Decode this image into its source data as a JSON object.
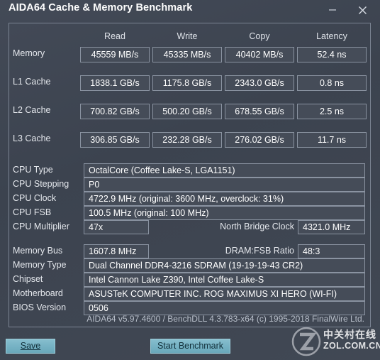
{
  "window": {
    "title": "AIDA64 Cache & Memory Benchmark",
    "minimize_label": "Minimize",
    "close_label": "Close"
  },
  "benchmark": {
    "columns": [
      "Read",
      "Write",
      "Copy",
      "Latency"
    ],
    "rows": [
      {
        "label": "Memory",
        "read": "45559 MB/s",
        "write": "45335 MB/s",
        "copy": "40402 MB/s",
        "latency": "52.4 ns"
      },
      {
        "label": "L1 Cache",
        "read": "1838.1 GB/s",
        "write": "1175.8 GB/s",
        "copy": "2343.0 GB/s",
        "latency": "0.8 ns"
      },
      {
        "label": "L2 Cache",
        "read": "700.82 GB/s",
        "write": "500.20 GB/s",
        "copy": "678.55 GB/s",
        "latency": "2.5 ns"
      },
      {
        "label": "L3 Cache",
        "read": "306.85 GB/s",
        "write": "232.28 GB/s",
        "copy": "276.02 GB/s",
        "latency": "11.7 ns"
      }
    ]
  },
  "cpu_info": {
    "type_label": "CPU Type",
    "type_value": "OctalCore   (Coffee Lake-S, LGA1151)",
    "stepping_label": "CPU Stepping",
    "stepping_value": "P0",
    "clock_label": "CPU Clock",
    "clock_value": "4722.9 MHz  (original: 3600 MHz, overclock: 31%)",
    "fsb_label": "CPU FSB",
    "fsb_value": "100.5 MHz  (original: 100 MHz)",
    "multiplier_label": "CPU Multiplier",
    "multiplier_value": "47x",
    "nb_clock_label": "North Bridge Clock",
    "nb_clock_value": "4321.0 MHz"
  },
  "memory_info": {
    "bus_label": "Memory Bus",
    "bus_value": "1607.8 MHz",
    "ratio_label": "DRAM:FSB Ratio",
    "ratio_value": "48:3",
    "type_label": "Memory Type",
    "type_value": "Dual Channel DDR4-3216 SDRAM  (19-19-19-43 CR2)",
    "chipset_label": "Chipset",
    "chipset_value": "Intel Cannon Lake Z390, Intel Coffee Lake-S",
    "motherboard_label": "Motherboard",
    "motherboard_value": "ASUSTeK COMPUTER INC. ROG MAXIMUS XI HERO (WI-FI)",
    "bios_label": "BIOS Version",
    "bios_value": "0506"
  },
  "footer": {
    "version_text": "AIDA64 v5.97.4600 / BenchDLL 4.3.783-x64  (c) 1995-2018 FinalWire Ltd.",
    "save_label": "Save",
    "start_label": "Start Benchmark"
  },
  "watermark": {
    "chinese": "中关村在线",
    "english": "ZOL.COM.CN"
  },
  "colors": {
    "window_bg": "#3d4450",
    "field_bg": "#454c58",
    "field_border": "#8a93a1",
    "panel_border": "#7b8493",
    "button_bg": "#76b2c4",
    "text": "#ffffff"
  }
}
